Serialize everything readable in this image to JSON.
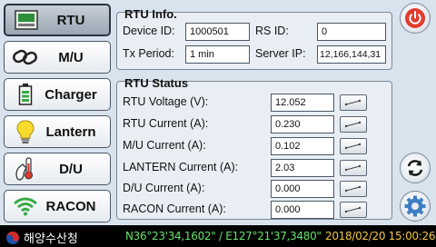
{
  "sidebar": {
    "items": [
      {
        "label": "RTU",
        "icon": "rtu-monitor-icon"
      },
      {
        "label": "M/U",
        "icon": "chain-link-icon"
      },
      {
        "label": "Charger",
        "icon": "battery-icon"
      },
      {
        "label": "Lantern",
        "icon": "lightbulb-icon"
      },
      {
        "label": "D/U",
        "icon": "thermometer-icon"
      },
      {
        "label": "RACON",
        "icon": "wifi-signal-icon"
      }
    ]
  },
  "rtu_info": {
    "title": "RTU Info.",
    "device_id_label": "Device ID:",
    "device_id_value": "1000501",
    "rs_id_label": "RS ID:",
    "rs_id_value": "0",
    "tx_period_label": "Tx Period:",
    "tx_period_value": "1 min",
    "server_ip_label": "Server IP:",
    "server_ip_value": "12,166,144,31"
  },
  "rtu_status": {
    "title": "RTU Status",
    "rows": [
      {
        "label": "RTU Voltage (V):",
        "value": "12.052"
      },
      {
        "label": "RTU Current (A):",
        "value": "0.230"
      },
      {
        "label": "M/U Current (A):",
        "value": "0.102"
      },
      {
        "label": "LANTERN Current (A):",
        "value": "2.03"
      },
      {
        "label": "D/U Current (A):",
        "value": "0.000"
      },
      {
        "label": "RACON Current (A):",
        "value": "0.000"
      }
    ]
  },
  "statusbar": {
    "org_name": "해양수산청",
    "coordinates": "N36°23'34,1602\" / E127°21'37,3480\"",
    "datetime": "2018/02/20 15:00:26"
  },
  "colors": {
    "power_red": "#e23b2e",
    "coord_green": "#66e36a",
    "clock_yellow": "#f2c641"
  }
}
